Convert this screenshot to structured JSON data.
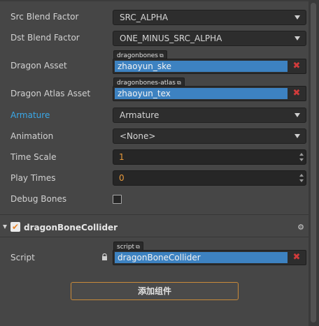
{
  "properties": {
    "src_blend": {
      "label": "Src Blend Factor",
      "value": "SRC_ALPHA"
    },
    "dst_blend": {
      "label": "Dst Blend Factor",
      "value": "ONE_MINUS_SRC_ALPHA"
    },
    "dragon_asset": {
      "label": "Dragon Asset",
      "tag": "dragonbones",
      "value": "zhaoyun_ske",
      "remove": "✖"
    },
    "dragon_atlas": {
      "label": "Dragon Atlas Asset",
      "tag": "dragonbones-atlas",
      "value": "zhaoyun_tex",
      "remove": "✖"
    },
    "armature": {
      "label": "Armature",
      "value": "Armature"
    },
    "animation": {
      "label": "Animation",
      "value": "<None>"
    },
    "time_scale": {
      "label": "Time Scale",
      "value": "1"
    },
    "play_times": {
      "label": "Play Times",
      "value": "0"
    },
    "debug_bones": {
      "label": "Debug Bones",
      "checked": false
    }
  },
  "component": {
    "title": "dragonBoneCollider",
    "enabled": true,
    "check_glyph": "✔",
    "gear_glyph": "⚙",
    "script": {
      "label": "Script",
      "tag": "script",
      "value": "dragonBoneCollider",
      "remove": "✖"
    }
  },
  "add_component_label": "添加组件",
  "icons": {
    "external": "⧉"
  },
  "colors": {
    "accent_blue": "#3aa8e8",
    "asset_highlight": "#3d82c1",
    "number_text": "#e89a3c",
    "button_border": "#c98a3a",
    "remove_red": "#d13b3b"
  }
}
